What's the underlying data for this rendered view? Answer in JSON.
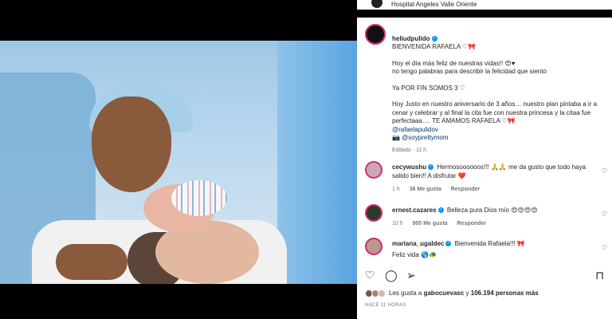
{
  "header": {
    "location": "Hospital Angeles Valle Oriente"
  },
  "post": {
    "username": "heliudpulido",
    "caption_title": "BIENVENIDA RAFAELA ♡🎀",
    "caption_p1": "Hoy el día más feliz de nuestras vidas!! 😍♥\nno tengo palabras para describir la felicidad que siento",
    "caption_p2": "Ya POR FIN SOMOS 3 ♡",
    "caption_p3": "Hoy Justo en nuestro aniversario de 3 años… nuestro plan pintaba a ir a cenar y celebrar y al final la cita fue con nuestra princesa y la citaa fue perfectaaa…. TE AMAMOS RAFAELA ♡🎀",
    "mention1": "@rafaelapulidov",
    "mention2": "📷 @soyprettymom",
    "edited": "Editado · 11 h"
  },
  "comments": [
    {
      "username": "cecywushu",
      "text": "Hermosoooooos!!! 🙏🙏 me da gusto que todo haya salido bien!! A disfrutar ❤️",
      "time": "1 h",
      "likes": "36 Me gusta",
      "reply": "Responder"
    },
    {
      "username": "ernest.cazares",
      "text": "Belleza pura Dios mío 😍😍😍😍",
      "time": "10 h",
      "likes": "905 Me gusta",
      "reply": "Responder"
    },
    {
      "username": "mariana_ugaldec",
      "text": "Bienvenida Rafaela!!! 🎀",
      "text2": "Feliz vida 🌎🐢"
    }
  ],
  "likes": {
    "prefix": "Les gusta a ",
    "user": "gabocuevasc",
    "middle": " y ",
    "count": "106.194 personas más"
  },
  "time_ago": "HACE 11 HORAS",
  "icons": [
    "heart-icon",
    "comment-icon",
    "share-icon",
    "bookmark-icon",
    "user-tag-icon"
  ],
  "colors": {
    "verified": "#0095f6",
    "link": "#00376b",
    "muted": "#737373"
  }
}
